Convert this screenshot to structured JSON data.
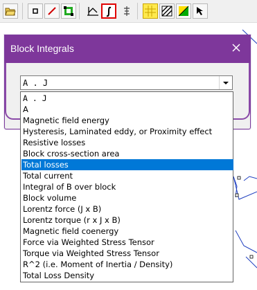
{
  "toolbar": {
    "buttons": [
      {
        "icon": "open-folder-icon"
      },
      {
        "icon": "select-point-icon"
      },
      {
        "icon": "draw-line-icon"
      },
      {
        "icon": "select-block-icon"
      },
      {
        "icon": "contour-plot-icon"
      },
      {
        "icon": "integral-icon",
        "active": true
      },
      {
        "icon": "zoom-icon"
      },
      {
        "icon": "grid-yellow-icon"
      },
      {
        "icon": "hatch-icon"
      },
      {
        "icon": "color-triangle-icon"
      },
      {
        "icon": "cursor-arrow-icon"
      }
    ]
  },
  "dialog": {
    "title": "Block Integrals",
    "combo_value": "A . J"
  },
  "dropdown": {
    "selected_index": 6,
    "items": [
      "A . J",
      "A",
      "Magnetic field energy",
      "Hysteresis, Laminated eddy, or Proximity effect",
      "Resistive losses",
      "Block cross-section area",
      "Total losses",
      "Total current",
      "Integral of B over block",
      "Block volume",
      "Lorentz force (J x B)",
      "Lorentz torque (r x J x B)",
      "Magnetic field coenergy",
      "Force via Weighted Stress Tensor",
      "Torque via Weighted Stress Tensor",
      "R^2 (i.e. Moment of Inertia / Density)",
      "Total Loss Density"
    ]
  },
  "colors": {
    "accent": "#7e379b",
    "selection": "#0078d7",
    "mesh": "#1f3fbf"
  }
}
